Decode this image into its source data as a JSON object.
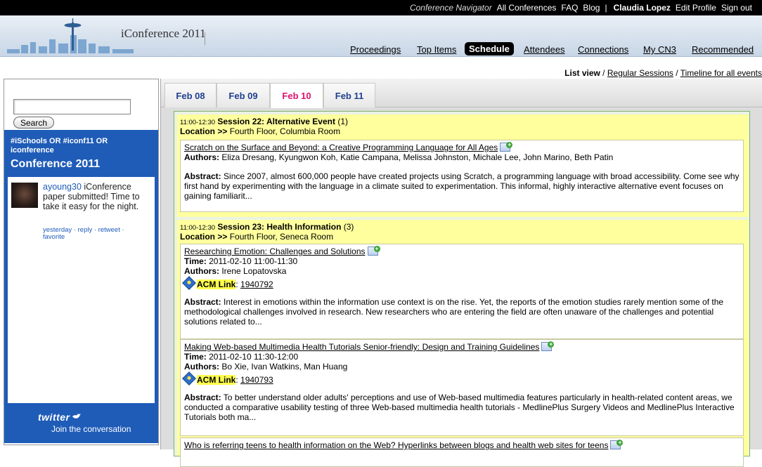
{
  "topbar": {
    "conference_navigator": "Conference Navigator",
    "all_conferences": "All Conferences",
    "faq": "FAQ",
    "blog": "Blog",
    "separator": "|",
    "user_name": "Claudia Lopez",
    "edit_profile": "Edit Profile",
    "sign_out": "Sign out"
  },
  "header": {
    "conference_title": "iConference 2011",
    "nav": {
      "proceedings": "Proceedings",
      "top_items": "Top Items",
      "schedule": "Schedule",
      "attendees": "Attendees",
      "connections": "Connections",
      "my_cn3": "My CN3",
      "recommended": "Recommended"
    }
  },
  "view_links": {
    "list_view": "List view",
    "sep1": " / ",
    "regular_sessions": "Regular Sessions",
    "sep2": " /  ",
    "timeline": "Timeline for all events"
  },
  "search": {
    "value": "",
    "button_label": "Search"
  },
  "twitter": {
    "query": "#iSchools OR #iconf11 OR iconference",
    "heading": "Conference 2011",
    "tweet": {
      "user": "ayoung30",
      "text": " iConference paper submitted! Time to take it easy for the night.",
      "actions": {
        "yesterday": "yesterday",
        "reply": "reply",
        "retweet": "retweet",
        "favorite": "favorite",
        "dot": " · "
      }
    },
    "footer_logo": "twitter",
    "footer_join": "Join the conversation"
  },
  "tabs": [
    {
      "label": "Feb 08"
    },
    {
      "label": "Feb 09"
    },
    {
      "label": "Feb 10"
    },
    {
      "label": "Feb 11"
    }
  ],
  "active_tab": "Feb 10",
  "sessions": [
    {
      "time": "11:00-12:30",
      "title": "Session 22: Alternative Event",
      "count": " (1)",
      "location_label": "Location >>",
      "location": " Fourth Floor, Columbia Room",
      "papers": [
        {
          "title": "Scratch on the Surface and Beyond: a Creative Programming Language for All Ages",
          "authors_label": "Authors:",
          "authors": " Eliza Dresang, Kyungwon Koh, Katie Campana, Melissa Johnston, Michale Lee, John Marino, Beth Patin",
          "abstract_label": "Abstract:",
          "abstract": " Since 2007, almost 600,000 people have created projects using Scratch, a programming language with broad accessibility. Come see why first hand by experimenting with the language in a climate suited to experimentation. This informal, highly interactive alternative event focuses on gaining familiarit..."
        }
      ]
    },
    {
      "time": "11:00-12:30",
      "title": "Session 23: Health Information",
      "count": " (3)",
      "location_label": "Location >>",
      "location": " Fourth Floor, Seneca Room",
      "papers": [
        {
          "title": "Researching Emotion: Challenges and Solutions",
          "time_label": "Time:",
          "time": " 2011-02-10 11:00-11:30",
          "authors_label": "Authors:",
          "authors": " Irene Lopatovska",
          "acm_label": "ACM Link",
          "acm_id": "1940792",
          "abstract_label": "Abstract:",
          "abstract": " Interest in emotions within the information use context is on the rise. Yet, the reports of the emotion studies rarely mention some of the methodological challenges involved in research. New researchers who are entering the field are often unaware of the challenges and potential solutions related to..."
        },
        {
          "title": "Making Web-based Multimedia Health Tutorials Senior-friendly: Design and Training Guidelines",
          "time_label": "Time:",
          "time": " 2011-02-10 11:30-12:00",
          "authors_label": "Authors:",
          "authors": " Bo Xie, Ivan Watkins, Man Huang",
          "acm_label": "ACM Link",
          "acm_id": "1940793",
          "abstract_label": "Abstract:",
          "abstract": " To better understand older adults' perceptions and use of Web-based multimedia features particularly in health-related content areas, we conducted a comparative usability testing of three Web-based multimedia health tutorials - MedlinePlus Surgery Videos and MedlinePlus Interactive Tutorials both ma..."
        },
        {
          "title": "Who is referring teens to health information on the Web? Hyperlinks between blogs and health web sites for teens"
        }
      ]
    }
  ],
  "colors": {
    "topbar_bg": "#000000",
    "twitter_blue": "#1f5cb8",
    "session_bg": "#ffff9e",
    "active_tab": "#e0106f",
    "tab_text": "#1f3f8f",
    "acm_highlight": "#ffff4d"
  },
  "icons": [
    "add-to-schedule-icon",
    "acm-diamond-icon",
    "twitter-bird-icon",
    "skyline-logo"
  ]
}
